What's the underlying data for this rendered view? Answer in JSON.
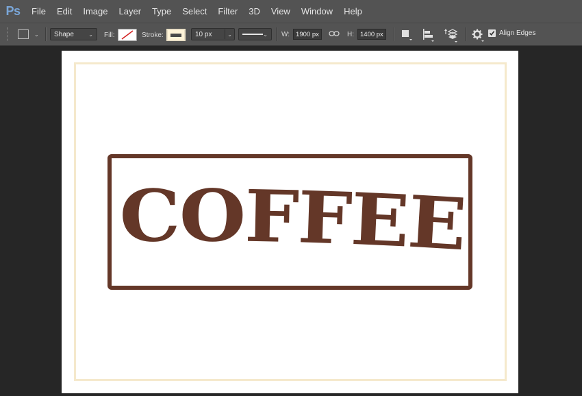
{
  "app": {
    "logo": "Ps",
    "menu": [
      "File",
      "Edit",
      "Image",
      "Layer",
      "Type",
      "Select",
      "Filter",
      "3D",
      "View",
      "Window",
      "Help"
    ]
  },
  "options": {
    "tool_icon": "rectangle-tool-icon",
    "mode_value": "Shape",
    "fill_label": "Fill:",
    "stroke_label": "Stroke:",
    "stroke_width": "10 px",
    "w_label": "W:",
    "w_value": "1900 px",
    "h_label": "H:",
    "h_value": "1400 px",
    "align_edges_label": "Align Edges",
    "align_edges_checked": true
  },
  "canvas": {
    "logo_text": "COFFEE",
    "colors": {
      "logo_brown": "#643728",
      "guide_cream": "#f5e9cc",
      "stroke_swatch": "#fff4d8",
      "workspace": "#262626",
      "chrome": "#535353"
    }
  }
}
